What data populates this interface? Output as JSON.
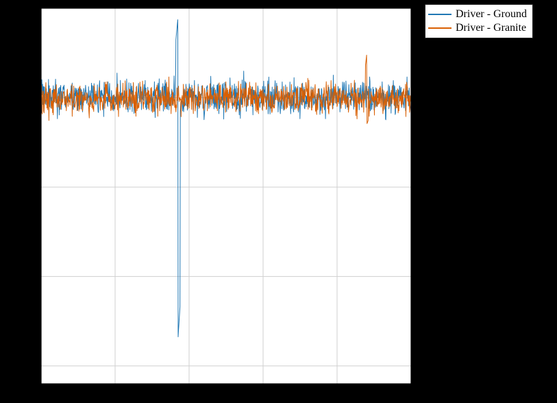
{
  "chart_data": {
    "type": "line",
    "title": "",
    "xlabel": "",
    "ylabel": "",
    "xlim": [
      0,
      1000
    ],
    "ylim": [
      -3.2,
      1.0
    ],
    "x_gridlines": [
      0,
      200,
      400,
      600,
      800,
      1000
    ],
    "y_gridlines": [
      -3.0,
      -2.0,
      -1.0,
      0.0,
      1.0
    ],
    "legend_position": "upper-right-outside",
    "note": "Noisy time-series; values read approximately from plot. Both series are a noise band centred near 0 with amplitude roughly ±0.3. The blue (Ground) series has a large transient near x≈370 reaching roughly +0.9 and dipping to about −2.7.",
    "series": [
      {
        "name": "Driver - Ground",
        "color": "#1f77b4",
        "baseline": 0.0,
        "noise_amplitude": 0.33,
        "n_points": 1000,
        "spikes": [
          {
            "x": 370,
            "y_max": 0.9,
            "y_min": -2.7,
            "width": 6
          }
        ],
        "sample_values": [
          {
            "x": 0,
            "y": 0.05
          },
          {
            "x": 100,
            "y": -0.12
          },
          {
            "x": 200,
            "y": 0.18
          },
          {
            "x": 300,
            "y": -0.2
          },
          {
            "x": 368,
            "y": 0.9
          },
          {
            "x": 372,
            "y": -2.7
          },
          {
            "x": 400,
            "y": 0.1
          },
          {
            "x": 500,
            "y": -0.05
          },
          {
            "x": 600,
            "y": 0.22
          },
          {
            "x": 700,
            "y": -0.15
          },
          {
            "x": 800,
            "y": 0.08
          },
          {
            "x": 900,
            "y": -0.18
          },
          {
            "x": 1000,
            "y": 0.12
          }
        ]
      },
      {
        "name": "Driver - Granite",
        "color": "#d95f02",
        "baseline": 0.0,
        "noise_amplitude": 0.3,
        "n_points": 1000,
        "spikes": [
          {
            "x": 880,
            "y_max": 0.48,
            "y_min": -0.3,
            "width": 4
          }
        ],
        "sample_values": [
          {
            "x": 0,
            "y": -0.08
          },
          {
            "x": 100,
            "y": 0.15
          },
          {
            "x": 200,
            "y": -0.1
          },
          {
            "x": 300,
            "y": 0.2
          },
          {
            "x": 370,
            "y": 0.05
          },
          {
            "x": 400,
            "y": -0.12
          },
          {
            "x": 500,
            "y": 0.18
          },
          {
            "x": 600,
            "y": -0.08
          },
          {
            "x": 700,
            "y": 0.22
          },
          {
            "x": 800,
            "y": -0.14
          },
          {
            "x": 880,
            "y": 0.48
          },
          {
            "x": 900,
            "y": 0.1
          },
          {
            "x": 1000,
            "y": -0.05
          }
        ]
      }
    ]
  }
}
